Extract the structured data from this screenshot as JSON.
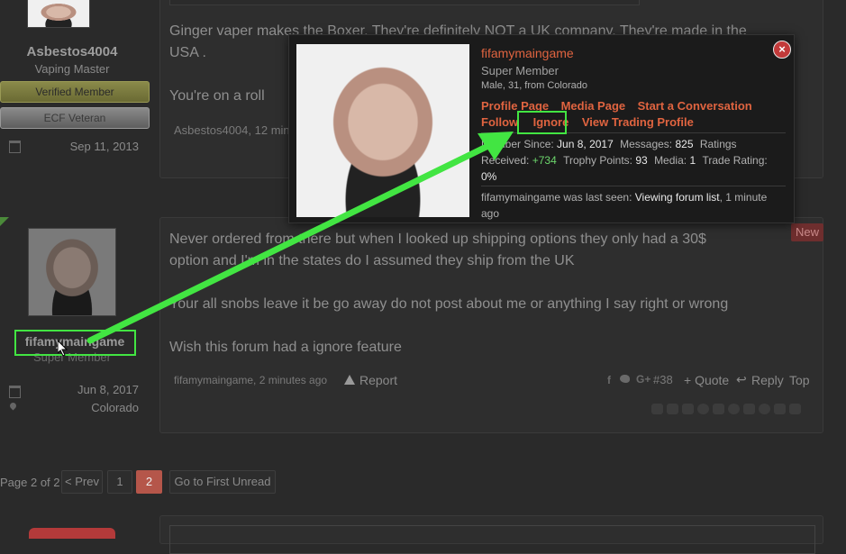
{
  "post1": {
    "username": "Asbestos4004",
    "title": "Vaping Master",
    "badge_verified": "Verified Member",
    "badge_ecf": "ECF Veteran",
    "joined": "Sep 11, 2013",
    "line1": "Ginger vaper makes the Boxer. They're definitely NOT a UK company. They're made in the",
    "line2": "USA .",
    "line3": "You're on a roll",
    "footer": "Asbestos4004, 12 min"
  },
  "post2": {
    "username": "fifamymaingame",
    "title": "Super Member",
    "joined": "Jun 8, 2017",
    "location": "Colorado",
    "new_label": "New",
    "line1": "Never ordered from there but when I looked up shipping options they only had a 30$",
    "line2": "option and I'm in the states do I assumed they ship from the UK",
    "line3": "Your all snobs leave it be go away do not post about me or anything I say right or wrong",
    "line4": "Wish this forum had a ignore feature",
    "footer_user": "fifamymaingame, 2 minutes ago",
    "report": "Report",
    "post_number": "#38",
    "quote": "+ Quote",
    "reply": "Reply",
    "top": "Top",
    "social_gplus": "G+"
  },
  "pagination": {
    "label": "Page 2 of 2",
    "prev": "< Prev",
    "page1": "1",
    "page2": "2",
    "first_unread": "Go to First Unread"
  },
  "tooltip": {
    "username": "fifamymaingame",
    "title": "Super Member",
    "info_prefix": "Male, 31, from ",
    "info_location": "Colorado",
    "links_row1": [
      "Profile Page",
      "Media Page",
      "Start a Conversation"
    ],
    "links_row2": [
      "Follow",
      "Ignore",
      "View Trading Profile"
    ],
    "member_since_label": "Member Since:",
    "member_since": "Jun 8, 2017",
    "messages_label": "Messages:",
    "messages": "825",
    "ratings_label": "Ratings",
    "received_label": "Received:",
    "received": "+734",
    "trophy_label": "Trophy Points:",
    "trophy": "93",
    "media_label": "Media:",
    "media": "1",
    "trade_label": "Trade Rating:",
    "trade": "0%",
    "last_seen_prefix": "fifamymaingame was last seen:",
    "last_seen_activity": "Viewing forum list",
    "last_seen_time": ", 1 minute ago"
  },
  "colors": {
    "accent": "#e06440",
    "highlight": "#42e542",
    "positive": "#6cd66c",
    "new_badge": "#8b3a3a"
  },
  "icons": [
    "calendar-icon",
    "location-icon",
    "warning-icon",
    "facebook-icon",
    "twitter-icon",
    "google-plus-icon",
    "reply-icon",
    "close-icon"
  ]
}
